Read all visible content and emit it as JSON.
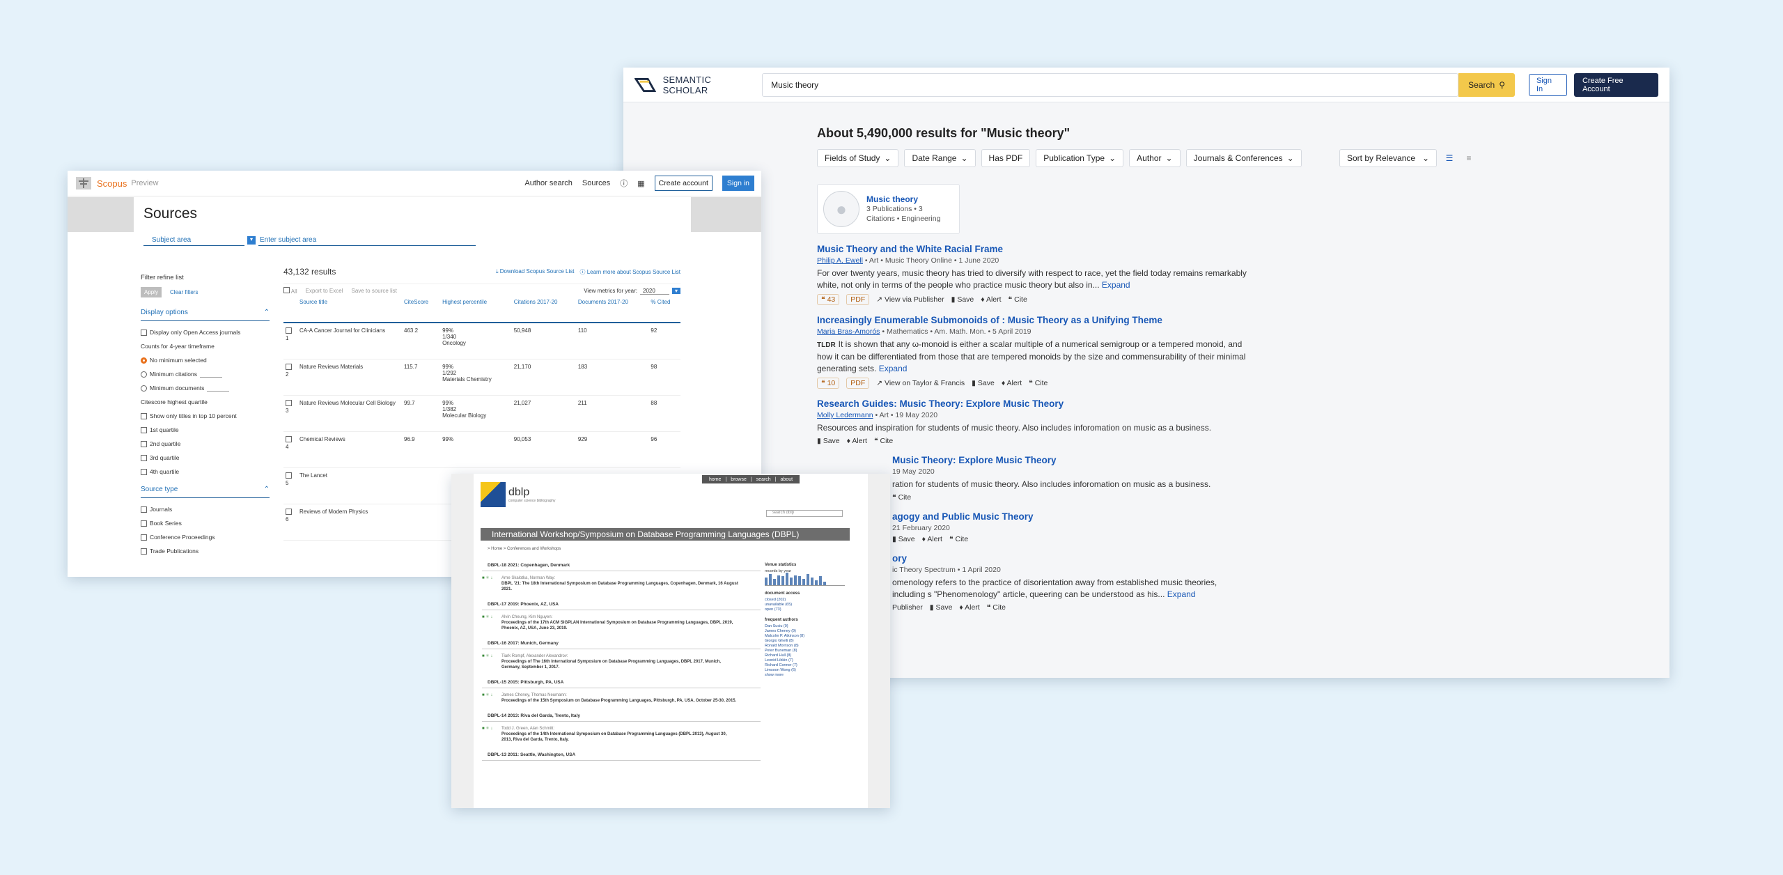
{
  "semantic_scholar": {
    "logo": "SEMANTIC SCHOLAR",
    "search_value": "Music theory",
    "search_button": "Search",
    "sign_in": "Sign In",
    "create_account": "Create Free Account",
    "results_heading": "About 5,490,000 results for \"Music theory\"",
    "filters": [
      "Fields of Study",
      "Date Range",
      "Has PDF",
      "Publication Type",
      "Author",
      "Journals & Conferences"
    ],
    "sort": "Sort by Relevance",
    "author_card": {
      "name": "Music theory",
      "line1": "3 Publications • 3",
      "line2": "Citations • Engineering"
    },
    "results": [
      {
        "title": "Music Theory and the White Racial Frame",
        "author": "Philip A. Ewell",
        "field": "Art",
        "venue": "Music Theory Online",
        "date": "1 June 2020",
        "abstract": "For over twenty years, music theory has tried to diversify with respect to race, yet the field today remains remarkably white, not only in terms of the people who practice music theory but also in...",
        "expand": "Expand",
        "citations": "43",
        "pdf": "PDF",
        "publisher": "View via Publisher",
        "save": "Save",
        "alert": "Alert",
        "cite": "Cite"
      },
      {
        "title": "Increasingly Enumerable Submonoids of : Music Theory as a Unifying Theme",
        "author": "Maria Bras-Amorós",
        "field": "Mathematics",
        "venue": "Am. Math. Mon.",
        "date": "5 April 2019",
        "tldr": "TLDR",
        "abstract": "It is shown that any ω-monoid is either a scalar multiple of a numerical semigroup or a tempered monoid, and how it can be differentiated from those that are tempered monoids by the size and commensurability of their minimal generating sets.",
        "expand": "Expand",
        "citations": "10",
        "pdf": "PDF",
        "publisher": "View on Taylor & Francis",
        "save": "Save",
        "alert": "Alert",
        "cite": "Cite"
      },
      {
        "title": "Research Guides: Music Theory: Explore Music Theory",
        "author": "Molly Ledermann",
        "field": "Art",
        "date": "19 May 2020",
        "abstract": "Resources and inspiration for students of music theory. Also includes inforomation on music as a business.",
        "save": "Save",
        "alert": "Alert",
        "cite": "Cite"
      },
      {
        "title": "Music Theory: Explore Music Theory",
        "date": "19 May 2020",
        "abstract": "ration for students of music theory. Also includes inforomation on music as a business.",
        "cite": "Cite"
      },
      {
        "title": "agogy and Public Music Theory",
        "date": "21 February 2020",
        "save": "Save",
        "alert": "Alert",
        "cite": "Cite"
      },
      {
        "title": "ory",
        "venue": "ic Theory Spectrum",
        "date": "1 April 2020",
        "abstract": "omenology refers to the practice of disorientation away from established music theories, including s \"Phenomenology\" article, queering can be understood as his...",
        "expand": "Expand",
        "publisher": "Publisher",
        "save": "Save",
        "alert": "Alert",
        "cite": "Cite"
      }
    ]
  },
  "scopus": {
    "brand": "Scopus",
    "brand_sub": "Preview",
    "nav": [
      "Author search",
      "Sources"
    ],
    "create_account": "Create account",
    "sign_in": "Sign in",
    "page_title": "Sources",
    "subject_area": "Subject area",
    "enter_subject": "Enter subject area",
    "filter_label": "Filter refine list",
    "apply": "Apply",
    "clear": "Clear filters",
    "display_options": "Display options",
    "display_items": [
      "Display only Open Access journals"
    ],
    "counts_label": "Counts for 4-year timeframe",
    "radios": [
      "No minimum selected",
      "Minimum citations",
      "Minimum documents"
    ],
    "quartile_label": "Citescore highest quartile",
    "quartiles": [
      "Show only titles in top 10 percent",
      "1st quartile",
      "2nd quartile",
      "3rd quartile",
      "4th quartile"
    ],
    "source_type": "Source type",
    "source_types": [
      "Journals",
      "Book Series",
      "Conference Proceedings",
      "Trade Publications"
    ],
    "results_count": "43,132 results",
    "download": "Download Scopus Source List",
    "learn_more": "Learn more about Scopus Source List",
    "tools": [
      "All",
      "Export to Excel",
      "Save to source list"
    ],
    "view_metrics": "View metrics for year:",
    "year": "2020",
    "columns": [
      "Source title",
      "CiteScore",
      "Highest percentile",
      "Citations 2017-20",
      "Documents 2017-20",
      "% Cited"
    ],
    "rows": [
      {
        "n": "1",
        "title": "CA-A Cancer Journal for Clinicians",
        "cs": "463.2",
        "pct": "99%",
        "rank": "1/340",
        "cat": "Oncology",
        "cit": "50,948",
        "docs": "110",
        "cited": "92"
      },
      {
        "n": "2",
        "title": "Nature Reviews Materials",
        "cs": "115.7",
        "pct": "99%",
        "rank": "1/292",
        "cat": "Materials Chemistry",
        "cit": "21,170",
        "docs": "183",
        "cited": "98"
      },
      {
        "n": "3",
        "title": "Nature Reviews Molecular Cell Biology",
        "cs": "99.7",
        "pct": "99%",
        "rank": "1/382",
        "cat": "Molecular Biology",
        "cit": "21,027",
        "docs": "211",
        "cited": "88"
      },
      {
        "n": "4",
        "title": "Chemical Reviews",
        "cs": "96.9",
        "pct": "99%",
        "rank": "",
        "cat": "",
        "cit": "90,053",
        "docs": "929",
        "cited": "96"
      },
      {
        "n": "5",
        "title": "The Lancet",
        "cs": "",
        "pct": "",
        "rank": "",
        "cat": "",
        "cit": "",
        "docs": "",
        "cited": ""
      },
      {
        "n": "6",
        "title": "Reviews of Modern Physics",
        "cs": "",
        "pct": "",
        "rank": "",
        "cat": "",
        "cit": "",
        "docs": "",
        "cited": ""
      }
    ]
  },
  "dblp": {
    "top_nav": [
      "home",
      "browse",
      "search",
      "about"
    ],
    "logo": "dblp",
    "logo_sub": "computer science bibliography",
    "search_placeholder": "search dblp",
    "title": "International Workshop/Symposium on Database Programming Languages (DBPL)",
    "breadcrumb": "> Home > Conferences and Workshops",
    "years": [
      {
        "head": "DBPL-18 2021: Copenhagen, Denmark",
        "authors": "Arne Skalotka, Norman Way:",
        "title": "DBPL '21: The 18th International Symposium on Database Programming Languages, Copenhagen, Denmark, 16 August 2021."
      },
      {
        "head": "DBPL-17 2019: Phoenix, AZ, USA",
        "authors": "Alvin Cheung, Kim Nguyen:",
        "title": "Proceedings of the 17th ACM SIGPLAN International Symposium on Database Programming Languages, DBPL 2019, Phoenix, AZ, USA, June 23, 2019."
      },
      {
        "head": "DBPL-16 2017: Munich, Germany",
        "authors": "Tiark Rompf, Alexander Alexandrov:",
        "title": "Proceedings of The 16th International Symposium on Database Programming Languages, DBPL 2017, Munich, Germany, September 1, 2017."
      },
      {
        "head": "DBPL-15 2015: Pittsburgh, PA, USA",
        "authors": "James Cheney, Thomas Neumann:",
        "title": "Proceedings of the 15th Symposium on Database Programming Languages, Pittsburgh, PA, USA, October 25-30, 2015."
      },
      {
        "head": "DBPL-14 2013: Riva del Garda, Trento, Italy",
        "authors": "Todd J. Green, Alan Schmitt:",
        "title": "Proceedings of the 14th International Symposium on Database Programming Languages (DBPL 2013), August 30, 2013, Riva del Garda, Trento, Italy."
      },
      {
        "head": "DBPL-13 2011: Seattle, Washington, USA"
      }
    ],
    "venue_stats": "Venue statistics",
    "records_by_year": "records by year",
    "doc_access": "document access",
    "access_items": [
      "closed (202)",
      "unavailable (65)",
      "open (73)"
    ],
    "frequent_authors": "frequent authors",
    "author_items": [
      "Dan Suciu (9)",
      "James Cheney (9)",
      "Malcolm P. Atkinson (8)",
      "Giorgio Ghelli (8)",
      "Ronald Morrison (8)",
      "Peter Buneman (8)",
      "Richard Hull (8)",
      "Leonid Libkin (7)",
      "Richard Connor (7)",
      "Limsoon Wong (6)"
    ],
    "show_more": "show more",
    "bar_levels": [
      0.6,
      0.9,
      0.5,
      0.8,
      0.7,
      1.0,
      0.6,
      0.8,
      0.7,
      0.5,
      0.9,
      0.6,
      0.4,
      0.7,
      0.3
    ]
  }
}
